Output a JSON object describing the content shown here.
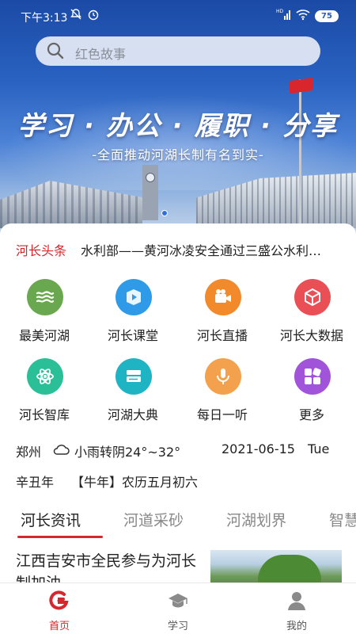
{
  "status_bar": {
    "time": "下午3:13",
    "battery": "75",
    "icons": [
      "mute-icon",
      "alarm-icon",
      "hd-signal-icon",
      "wifi-icon",
      "battery-icon"
    ]
  },
  "search": {
    "placeholder": "红色故事",
    "icon": "search-icon"
  },
  "banner": {
    "title": "学习 · 办公 · 履职 · 分享",
    "subtitle": "-全面推动河湖长制有名到实-"
  },
  "headline": {
    "tag": "河长头条",
    "text": "水利部——黄河冰凌安全通过三盛公水利…"
  },
  "quick_menu": [
    {
      "label": "最美河湖",
      "icon": "waves-icon",
      "color": "#6aa84f"
    },
    {
      "label": "河长课堂",
      "icon": "play-box-icon",
      "color": "#2f9be8"
    },
    {
      "label": "河长直播",
      "icon": "video-camera-icon",
      "color": "#f28a2b"
    },
    {
      "label": "河长大数据",
      "icon": "data-cube-icon",
      "color": "#ea4f55"
    },
    {
      "label": "河长智库",
      "icon": "atom-icon",
      "color": "#2bbf98"
    },
    {
      "label": "河湖大典",
      "icon": "book-icon",
      "color": "#1fb4c4"
    },
    {
      "label": "每日一听",
      "icon": "microphone-icon",
      "color": "#f3a14c"
    },
    {
      "label": "更多",
      "icon": "apps-icon",
      "color": "#a154d9"
    }
  ],
  "weather": {
    "city": "郑州",
    "condition": "小雨转阴24°~32°",
    "date": "2021-06-15",
    "weekday": "Tue",
    "lunar_year": "辛丑年",
    "zodiac": "【牛年】农历五月初六"
  },
  "tabs": [
    {
      "label": "河长资讯",
      "active": true
    },
    {
      "label": "河道采砂",
      "active": false
    },
    {
      "label": "河湖划界",
      "active": false
    },
    {
      "label": "智慧",
      "active": false
    }
  ],
  "news": {
    "title": "江西吉安市全民参与为河长制加油"
  },
  "bottom_nav": [
    {
      "label": "首页",
      "icon": "home-logo-icon",
      "active": true
    },
    {
      "label": "学习",
      "icon": "graduation-cap-icon",
      "active": false
    },
    {
      "label": "我的",
      "icon": "user-icon",
      "active": false
    }
  ],
  "colors": {
    "accent": "#d7262d",
    "active_nav": "#d7262d"
  }
}
